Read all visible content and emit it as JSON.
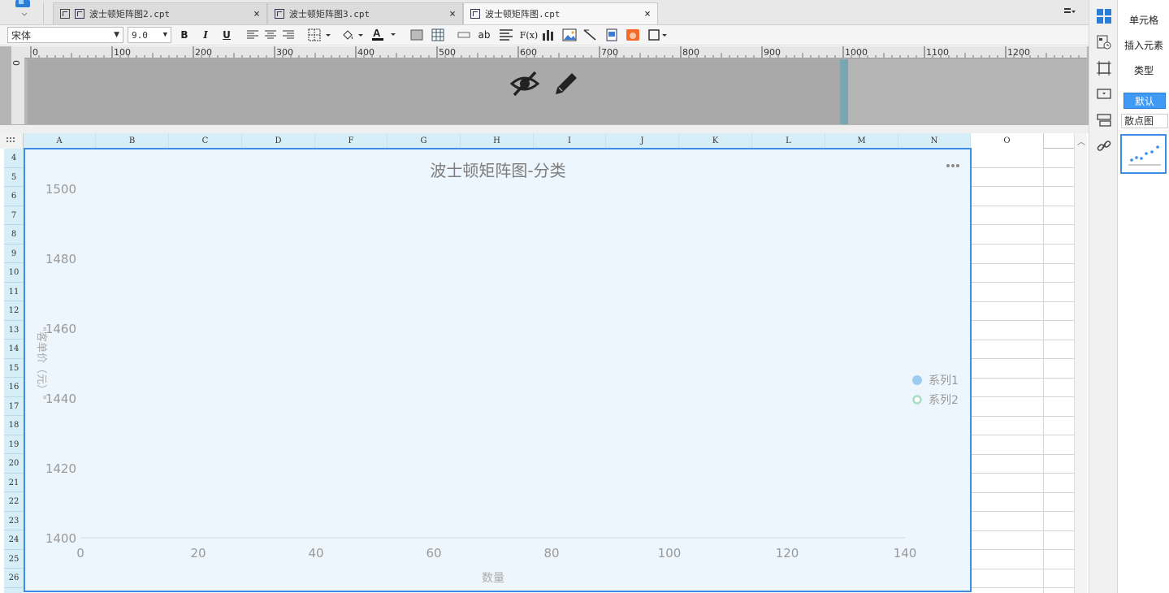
{
  "tabs": [
    {
      "label": "波士顿矩阵图2.cpt"
    },
    {
      "label": "波士顿矩阵图3.cpt"
    },
    {
      "label": "波士顿矩阵图.cpt"
    }
  ],
  "toolbar": {
    "font_name": "宋体",
    "font_size": "9.0",
    "bold": "B",
    "italic": "I",
    "underline": "U",
    "text_btn": "ab",
    "formula_btn": "F(x)"
  },
  "ruler": {
    "ticks": [
      "0",
      "100",
      "200",
      "300",
      "400",
      "500",
      "600",
      "700",
      "800",
      "900",
      "1000",
      "1100",
      "1200"
    ],
    "vertical_zero": "0"
  },
  "columns": [
    "A",
    "B",
    "C",
    "D",
    "F",
    "G",
    "H",
    "I",
    "J",
    "K",
    "L",
    "M",
    "N",
    "O"
  ],
  "rows": [
    "4",
    "5",
    "6",
    "7",
    "8",
    "9",
    "10",
    "11",
    "12",
    "13",
    "14",
    "15",
    "16",
    "17",
    "18",
    "19",
    "20",
    "21",
    "22",
    "23",
    "24",
    "25",
    "26"
  ],
  "right_panel": {
    "cell": "单元格",
    "insert_element": "插入元素",
    "type": "类型",
    "default": "默认",
    "chart_type": "散点图"
  },
  "chart_data": {
    "type": "scatter",
    "title": "波士顿矩阵图-分类",
    "xlabel": "数量",
    "ylabel": "\"客单价（元）\"",
    "xlim": [
      0,
      140
    ],
    "ylim": [
      1400,
      1500
    ],
    "xticks": [
      "0",
      "20",
      "40",
      "60",
      "80",
      "100",
      "120",
      "140"
    ],
    "yticks": [
      "1500",
      "1480",
      "1460",
      "1440",
      "1420",
      "1400"
    ],
    "series": [
      {
        "name": "系列1",
        "color": "#9ccbf2",
        "marker": "filled-circle",
        "points": []
      },
      {
        "name": "系列2",
        "color": "#a8dfc0",
        "marker": "hollow-circle",
        "points": []
      }
    ],
    "legend": "right",
    "grid": false,
    "menu_icon": "more-dots-icon"
  }
}
